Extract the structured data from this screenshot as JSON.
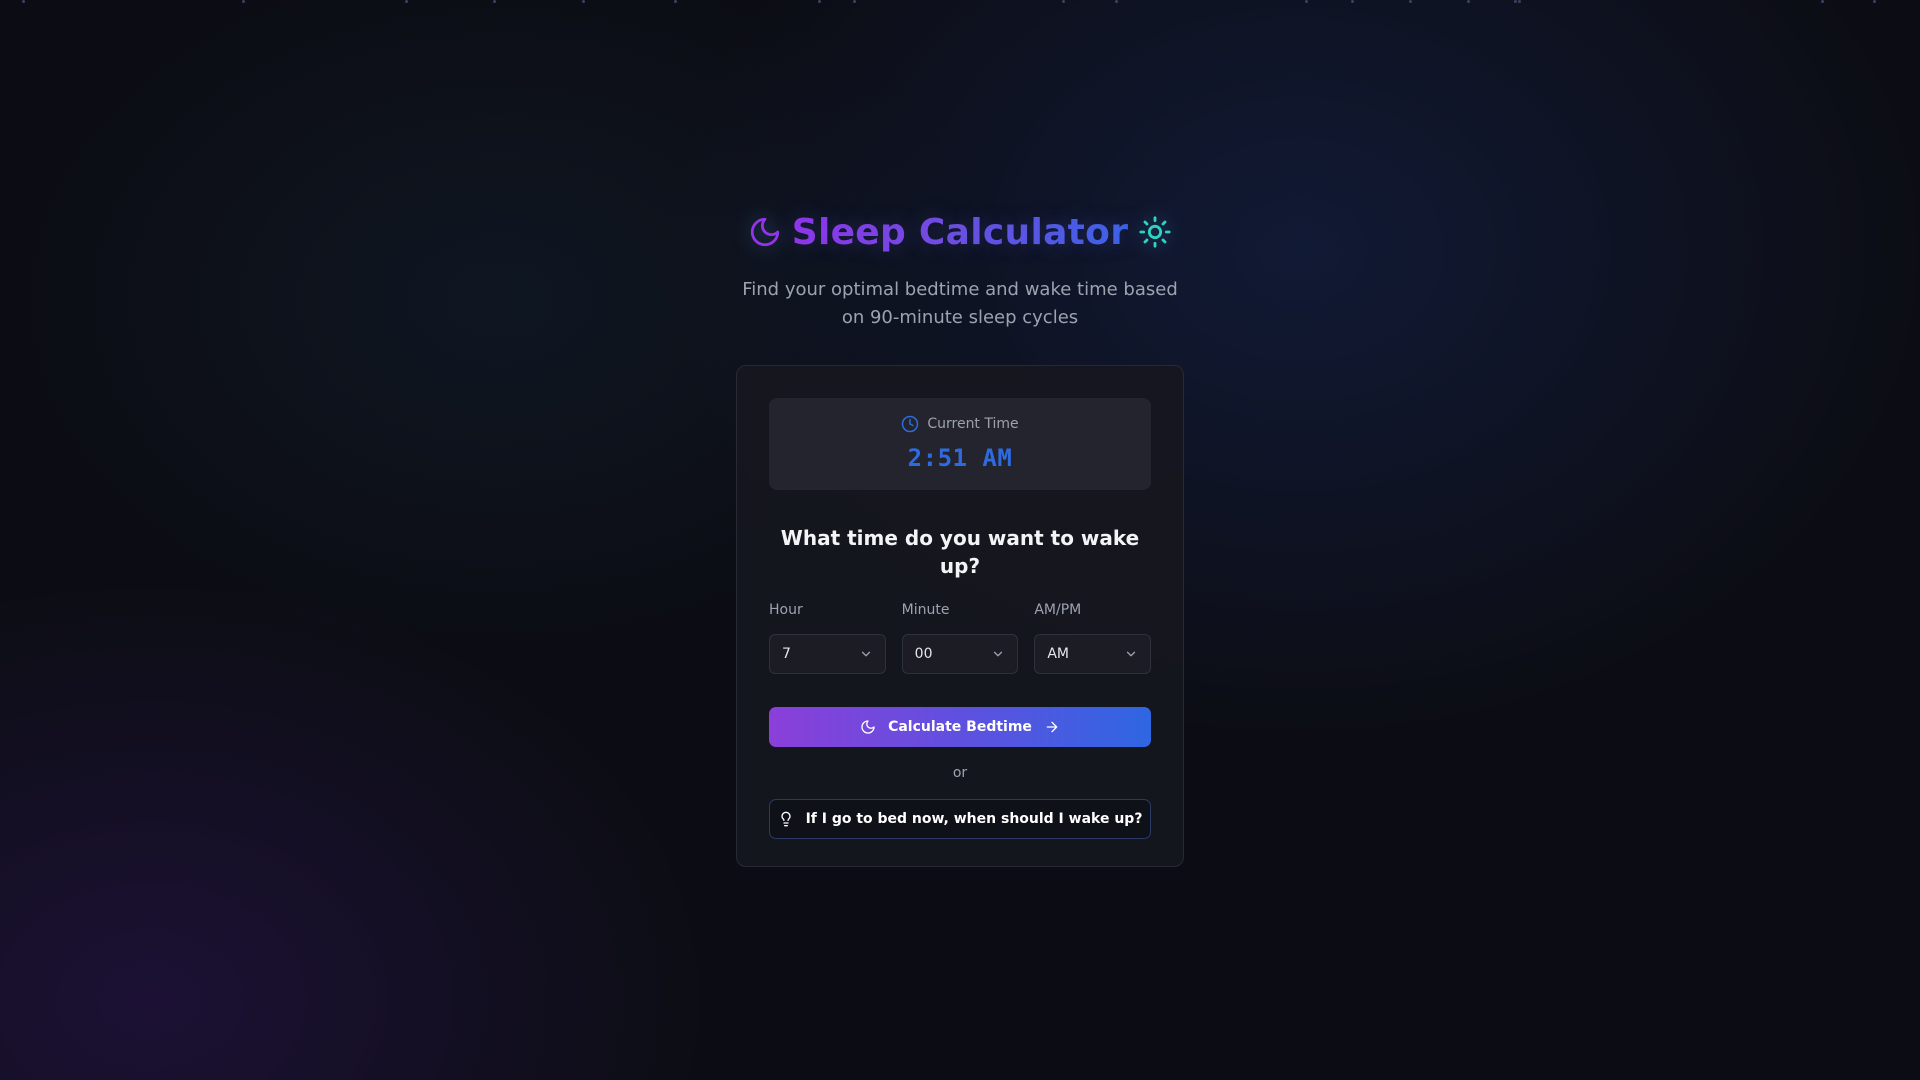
{
  "header": {
    "title": "Sleep Calculator",
    "subtitle": "Find your optimal bedtime and wake time based on 90-minute sleep cycles",
    "left_icon": "moon-icon",
    "right_icon": "sun-icon"
  },
  "current_time": {
    "label": "Current Time",
    "value": "2:51 AM",
    "icon": "clock-icon"
  },
  "form": {
    "question": "What time do you want to wake up?",
    "hour": {
      "label": "Hour",
      "value": "7"
    },
    "minute": {
      "label": "Minute",
      "value": "00"
    },
    "ampm": {
      "label": "AM/PM",
      "value": "AM"
    }
  },
  "actions": {
    "calculate_label": "Calculate Bedtime",
    "or_label": "or",
    "bed_now_label": "If I go to bed now, when should I wake up?"
  },
  "colors": {
    "accent_purple": "#9333ea",
    "accent_blue": "#2f6be0",
    "sun_teal": "#2dd4bf",
    "background": "#0c0d14"
  }
}
